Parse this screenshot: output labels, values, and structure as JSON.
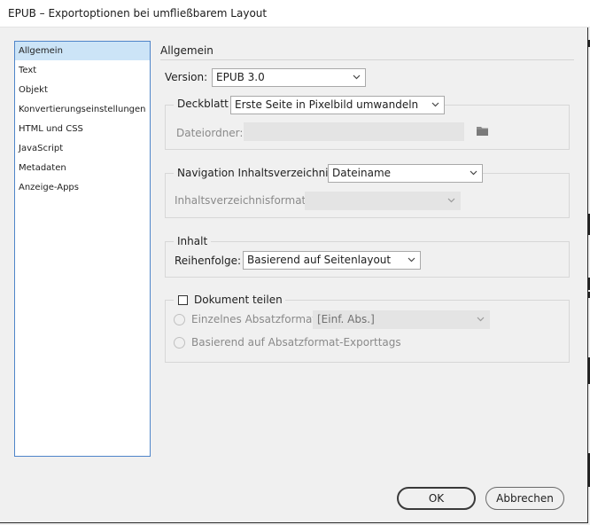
{
  "window": {
    "title": "EPUB – Exportoptionen bei umfließbarem Layout"
  },
  "sidebar": {
    "items": [
      {
        "label": "Allgemein",
        "selected": true
      },
      {
        "label": "Text"
      },
      {
        "label": "Objekt"
      },
      {
        "label": "Konvertierungseinstellungen"
      },
      {
        "label": "HTML und CSS"
      },
      {
        "label": "JavaScript"
      },
      {
        "label": "Metadaten"
      },
      {
        "label": "Anzeige-Apps"
      }
    ]
  },
  "main": {
    "section_title": "Allgemein",
    "version": {
      "label": "Version:",
      "value": "EPUB 3.0"
    },
    "cover": {
      "label": "Deckblatt",
      "value": "Erste Seite in Pixelbild umwandeln",
      "folder_label": "Dateiordner:",
      "folder_value": ""
    },
    "navigation": {
      "label": "Navigation Inhaltsverzeichnis",
      "value": "Dateiname",
      "toc_format_label": "Inhaltsverzeichnisformat:",
      "toc_format_value": ""
    },
    "content": {
      "label": "Inhalt",
      "order_label": "Reihenfolge:",
      "order_value": "Basierend auf Seitenlayout"
    },
    "split": {
      "label": "Dokument teilen",
      "checked": false,
      "option_single_label": "Einzelnes Absatzformat",
      "option_single_value": "[Einf. Abs.]",
      "option_tags_label": "Basierend auf Absatzformat-Exporttags"
    }
  },
  "footer": {
    "ok_label": "OK",
    "cancel_label": "Abbrechen"
  },
  "colors": {
    "selection": "#cce4f7",
    "sidebar_border": "#4f85c9",
    "dialog_bg": "#f0f0f0"
  },
  "icons": {
    "dropdown": "chevron-down-icon",
    "folder": "folder-icon"
  }
}
